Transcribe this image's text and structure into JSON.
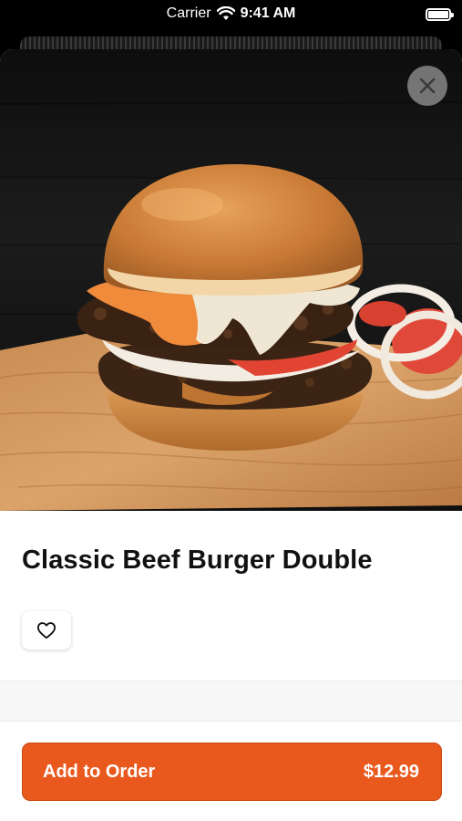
{
  "status_bar": {
    "carrier": "Carrier",
    "time": "9:41 AM"
  },
  "product": {
    "title": "Classic Beef Burger Double"
  },
  "order_button": {
    "label": "Add to Order",
    "price": "$12.99"
  },
  "icons": {
    "close": "close-icon",
    "favorite": "heart-icon",
    "wifi": "wifi-icon",
    "battery": "battery-icon"
  },
  "colors": {
    "accent": "#e9591e",
    "text": "#111111"
  }
}
